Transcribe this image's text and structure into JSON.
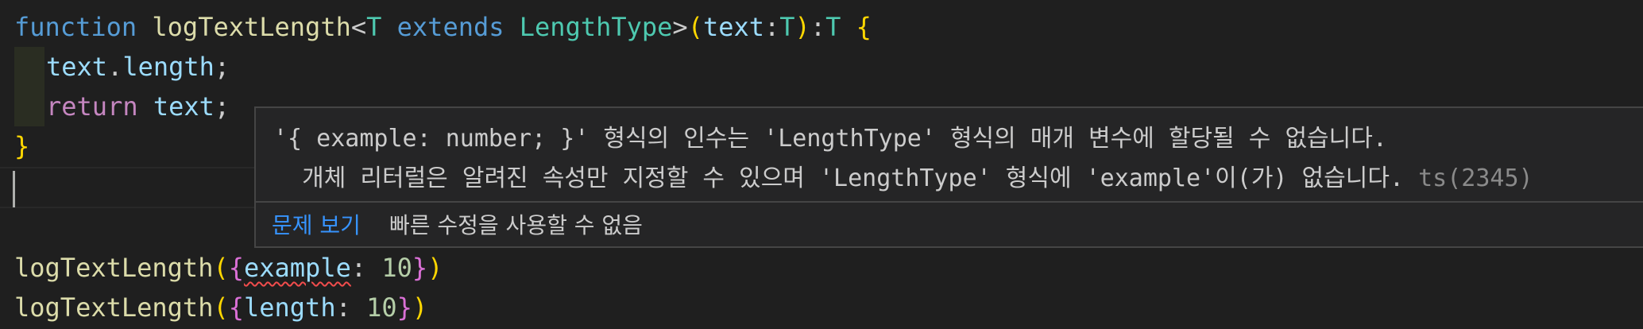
{
  "editor": {
    "line1": {
      "kw_function": "function",
      "fn_name": "logTextLength",
      "lt": "<",
      "type_param": "T",
      "kw_extends": "extends",
      "constraint": "LengthType",
      "gt": ">",
      "paren_open": "(",
      "param": "text",
      "colon": ":",
      "param_type": "T",
      "paren_close": ")",
      "ret_colon": ":",
      "ret_type": "T",
      "brace_open": "{"
    },
    "line2": {
      "obj": "text",
      "dot": ".",
      "prop": "length",
      "semi": ";"
    },
    "line3": {
      "kw_return": "return",
      "value": "text",
      "semi": ";"
    },
    "line4": {
      "brace_close": "}"
    },
    "line7": {
      "fn_name": "logTextLength",
      "paren_open": "(",
      "brace_open": "{",
      "key": "example",
      "colon": ": ",
      "value": "10",
      "brace_close": "}",
      "paren_close": ")"
    },
    "line8": {
      "fn_name": "logTextLength",
      "paren_open": "(",
      "brace_open": "{",
      "key": "length",
      "colon": ": ",
      "value": "10",
      "brace_close": "}",
      "paren_close": ")"
    }
  },
  "hover": {
    "line1": "'{ example: number; }' 형식의 인수는 'LengthType' 형식의 매개 변수에 할당될 수 없습니다.",
    "line2": "  개체 리터럴은 알려진 속성만 지정할 수 있으며 'LengthType' 형식에 'example'이(가) 없습니다.",
    "ts_code": " ts(2345)",
    "view_problem": "문제 보기",
    "no_quick_fix": "빠른 수정을 사용할 수 없음"
  },
  "colors": {
    "background": "#1f1f1f",
    "keyword": "#569cd6",
    "function": "#dcdcaa",
    "type": "#4ec9b0",
    "variable": "#9cdcfe",
    "control": "#c586c0",
    "error": "#f14c4c",
    "link": "#3794ff"
  }
}
